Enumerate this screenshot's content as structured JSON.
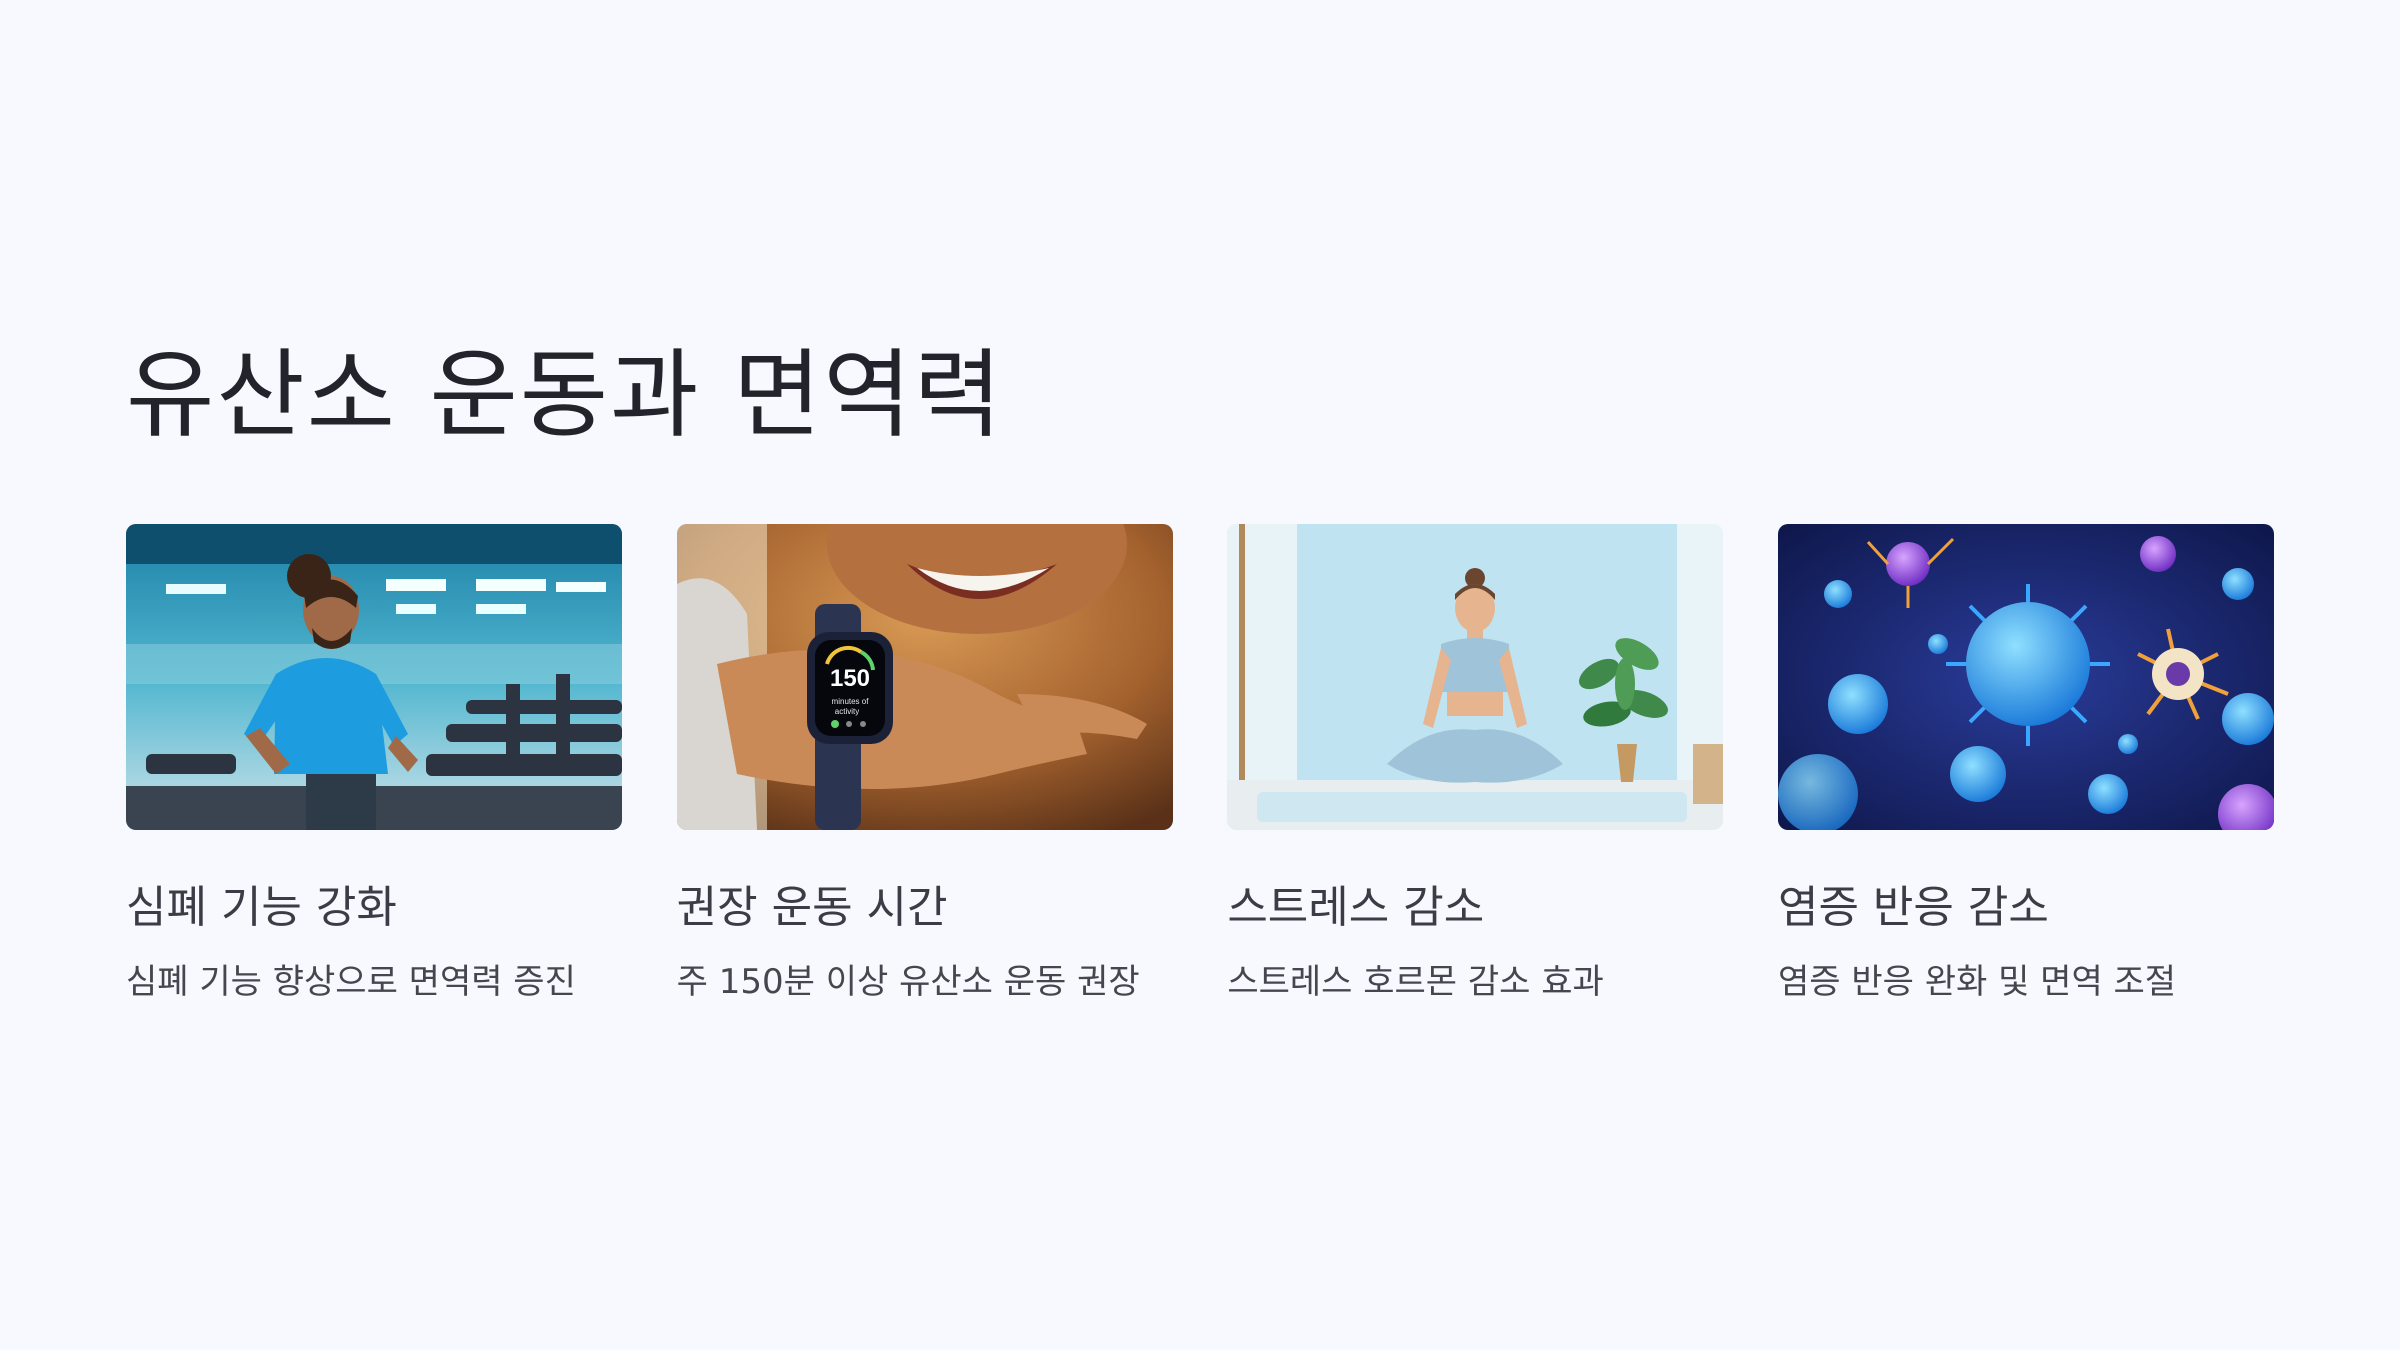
{
  "slide": {
    "title": "유산소 운동과 면역력"
  },
  "cards": [
    {
      "title": "심폐 기능 강화",
      "description": "심폐 기능 향상으로 면역력 증진",
      "image_subject": "man-running-treadmill"
    },
    {
      "title": "권장 운동 시간",
      "description": "주 150분 이상 유산소 운동 권장",
      "image_subject": "smartwatch-activity",
      "watch_display": {
        "value": "150",
        "caption_line1": "minutes of",
        "caption_line2": "activity"
      }
    },
    {
      "title": "스트레스 감소",
      "description": "스트레스 호르몬 감소 효과",
      "image_subject": "woman-meditating"
    },
    {
      "title": "염증 반응 감소",
      "description": "염증 반응 완화 및 면역 조절",
      "image_subject": "immune-cells-virus"
    }
  ],
  "colors": {
    "background": "#f8f9fe",
    "title_text": "#23242b",
    "card_title_text": "#3b3c45",
    "card_desc_text": "#45464f"
  }
}
